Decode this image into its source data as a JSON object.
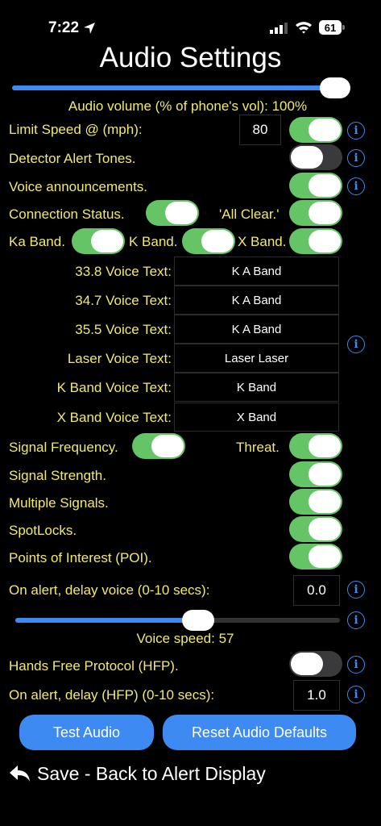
{
  "status": {
    "time": "7:22",
    "battery": "61"
  },
  "title": "Audio Settings",
  "volume": {
    "label": "Audio volume (% of phone's vol): 100%",
    "level": 1.0
  },
  "limit_speed": {
    "label": "Limit Speed @ (mph):",
    "value": "80",
    "on": true
  },
  "detector_tones": {
    "label": "Detector Alert Tones.",
    "on": false
  },
  "voice_ann": {
    "label": "Voice announcements.",
    "on": true
  },
  "connection": {
    "label": "Connection Status.",
    "on": true
  },
  "all_clear": {
    "label": "'All Clear.'",
    "on": true
  },
  "bands": {
    "ka": "Ka Band.",
    "k": "K Band.",
    "x": "X Band."
  },
  "voice_texts": [
    {
      "label": "33.8 Voice Text:",
      "value": "K A Band"
    },
    {
      "label": "34.7 Voice Text:",
      "value": "K A Band"
    },
    {
      "label": "35.5 Voice Text:",
      "value": "K A Band"
    },
    {
      "label": "Laser Voice Text:",
      "value": "Laser Laser"
    },
    {
      "label": "K Band Voice Text:",
      "value": "K Band"
    },
    {
      "label": "X Band Voice Text:",
      "value": "X Band"
    }
  ],
  "signal_freq": {
    "label": "Signal Frequency.",
    "on": true
  },
  "threat": {
    "label": "Threat.",
    "on": true
  },
  "signal_strength": {
    "label": "Signal Strength.",
    "on": true
  },
  "multiple": {
    "label": "Multiple Signals.",
    "on": true
  },
  "spotlocks": {
    "label": "SpotLocks.",
    "on": true
  },
  "poi": {
    "label": "Points of Interest (POI).",
    "on": true
  },
  "delay_voice": {
    "label": "On alert, delay voice (0-10 secs):",
    "value": "0.0"
  },
  "voice_speed": {
    "label": "Voice speed: 57",
    "level": 0.57
  },
  "hfp": {
    "label": "Hands Free Protocol (HFP).",
    "on": false
  },
  "delay_hfp": {
    "label": "On alert, delay (HFP) (0-10 secs):",
    "value": "1.0"
  },
  "buttons": {
    "test": "Test Audio",
    "reset": "Reset Audio Defaults"
  },
  "back": {
    "label": "Save - Back to Alert Display"
  },
  "info_glyph": "i"
}
